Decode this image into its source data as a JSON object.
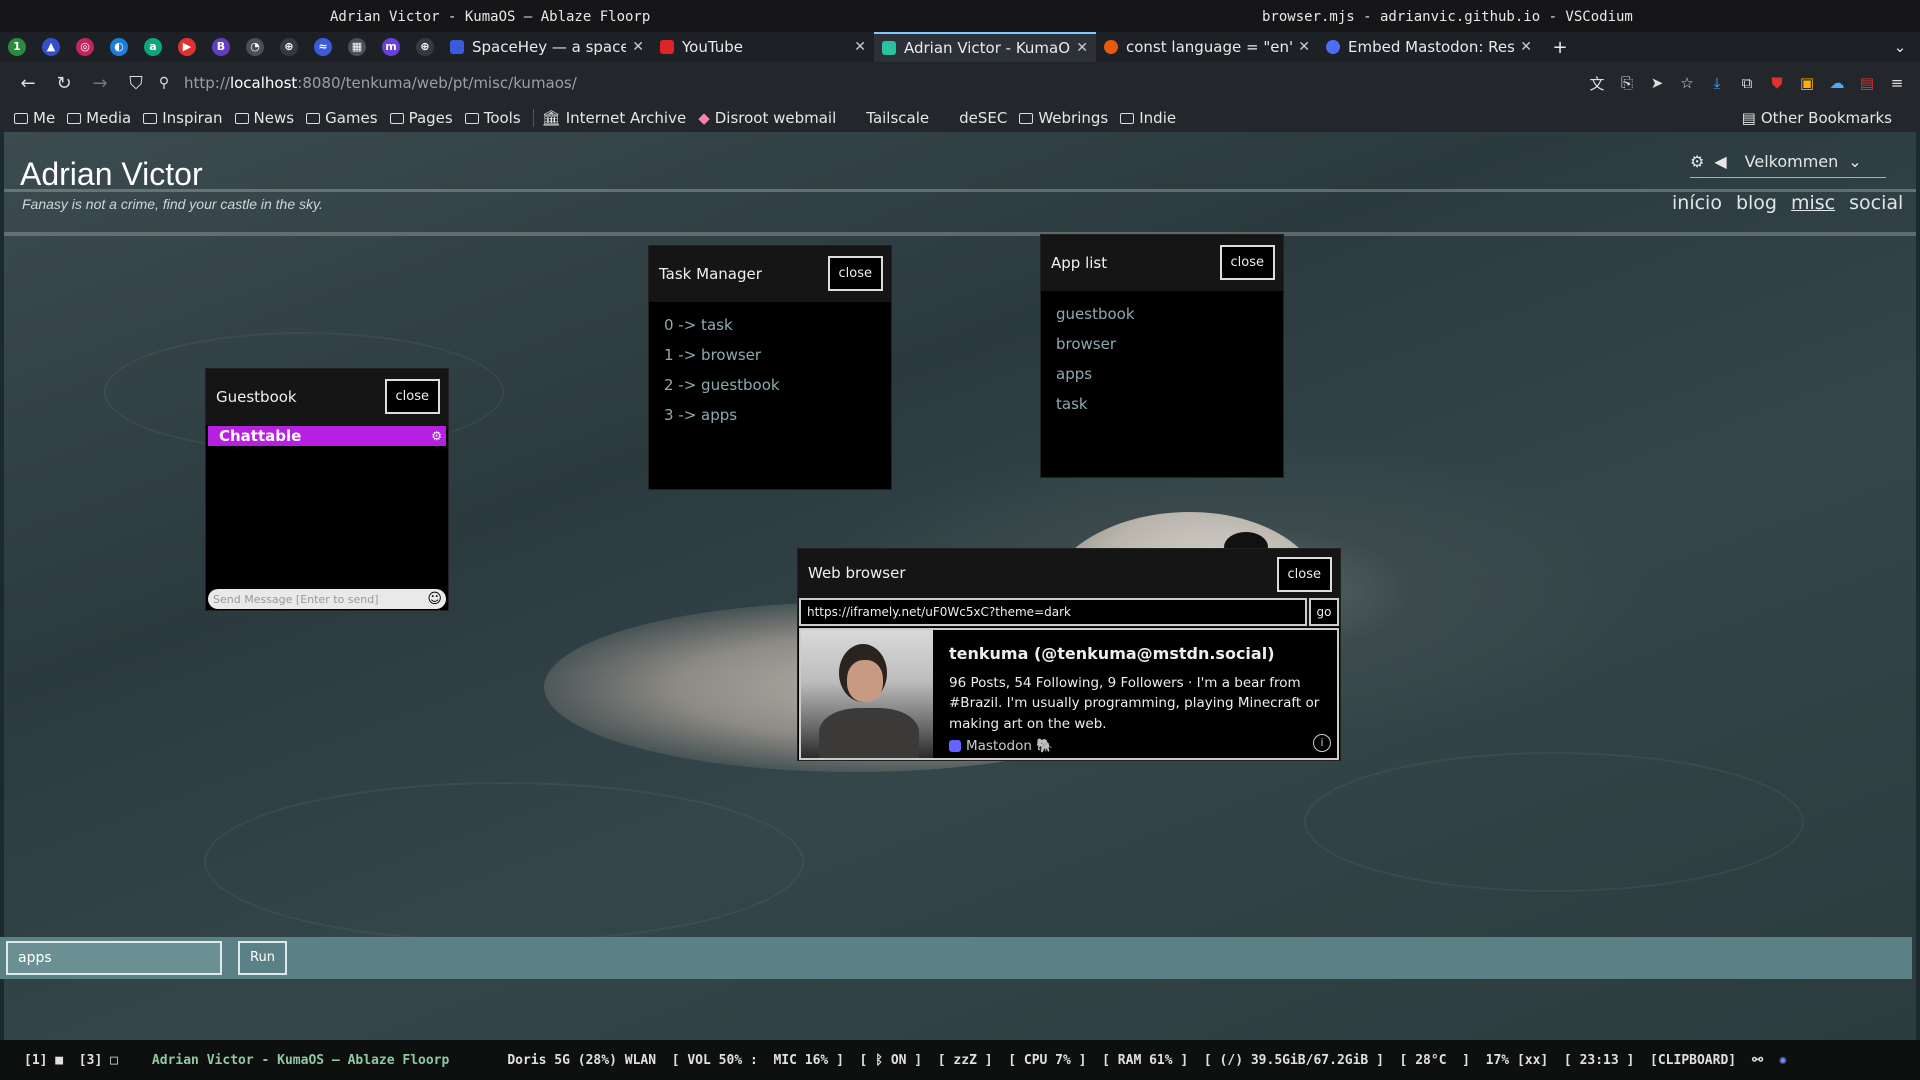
{
  "window_titles": {
    "left": "Adrian Victor - KumaOS — Ablaze Floorp",
    "right": "browser.mjs - adrianvic.github.io - VSCodium"
  },
  "tabs": [
    {
      "label": "SpaceHey — a space",
      "color": "#3b5bdb"
    },
    {
      "label": "YouTube",
      "color": "#e02424"
    },
    {
      "label": "Adrian Victor - KumaOS",
      "color": "#2bc0a0",
      "active": true
    },
    {
      "label": "const language = \"en\";",
      "color": "#e8590c"
    },
    {
      "label": "Embed Mastodon: Respo",
      "color": "#4c6ef5"
    }
  ],
  "url": {
    "prefix": "http://",
    "host": "localhost",
    "rest": ":8080/tenkuma/web/pt/misc/kumaos/"
  },
  "bookmarks": [
    "Me",
    "Media",
    "Inspiran",
    "News",
    "Games",
    "Pages",
    "Tools",
    "Internet Archive",
    "Disroot webmail",
    "Tailscale",
    "deSEC",
    "Webrings",
    "Indie"
  ],
  "other_bookmarks": "Other Bookmarks",
  "site": {
    "title": "Adrian Victor",
    "tagline": "Fanasy is not a crime, find your castle in the sky.",
    "language": "Velkommen",
    "nav": [
      "início",
      "blog",
      "misc",
      "social"
    ]
  },
  "task_manager": {
    "title": "Task Manager",
    "close": "close",
    "items": [
      "0 -> task",
      "1 -> browser",
      "2 -> guestbook",
      "3 -> apps"
    ]
  },
  "app_list": {
    "title": "App list",
    "close": "close",
    "items": [
      "guestbook",
      "browser",
      "apps",
      "task"
    ]
  },
  "guestbook": {
    "title": "Guestbook",
    "close": "close",
    "brand": "Chattable",
    "placeholder": "Send Message [Enter to send]"
  },
  "web_browser": {
    "title": "Web browser",
    "close": "close",
    "url": "https://iframely.net/uF0Wc5xC?theme=dark",
    "go": "go",
    "card": {
      "name": "tenkuma (@tenkuma@mstdn.social)",
      "bio": "96 Posts, 54 Following, 9 Followers · I'm a bear from #Brazil. I'm usually programming, playing Minecraft or making art on the web.",
      "source": "Mastodon 🐘"
    }
  },
  "run": {
    "value": "apps",
    "button": "Run"
  },
  "statusbar": {
    "workspaces": "[1] ■  [3] □",
    "title": "Adrian Victor - KumaOS — Ablaze Floorp",
    "info": "Doris 5G (28%) WLAN  [ VOL 50% :  MIC 16% ]  [ ᛒ ON ]  [ zzZ ]  [ CPU 7% ]  [ RAM 61% ]  [ (/) 39.5GiB/67.2GiB ]  [ 28°C  ]  17% [xx]  [ 23:13 ]  [CLIPBOARD]"
  }
}
